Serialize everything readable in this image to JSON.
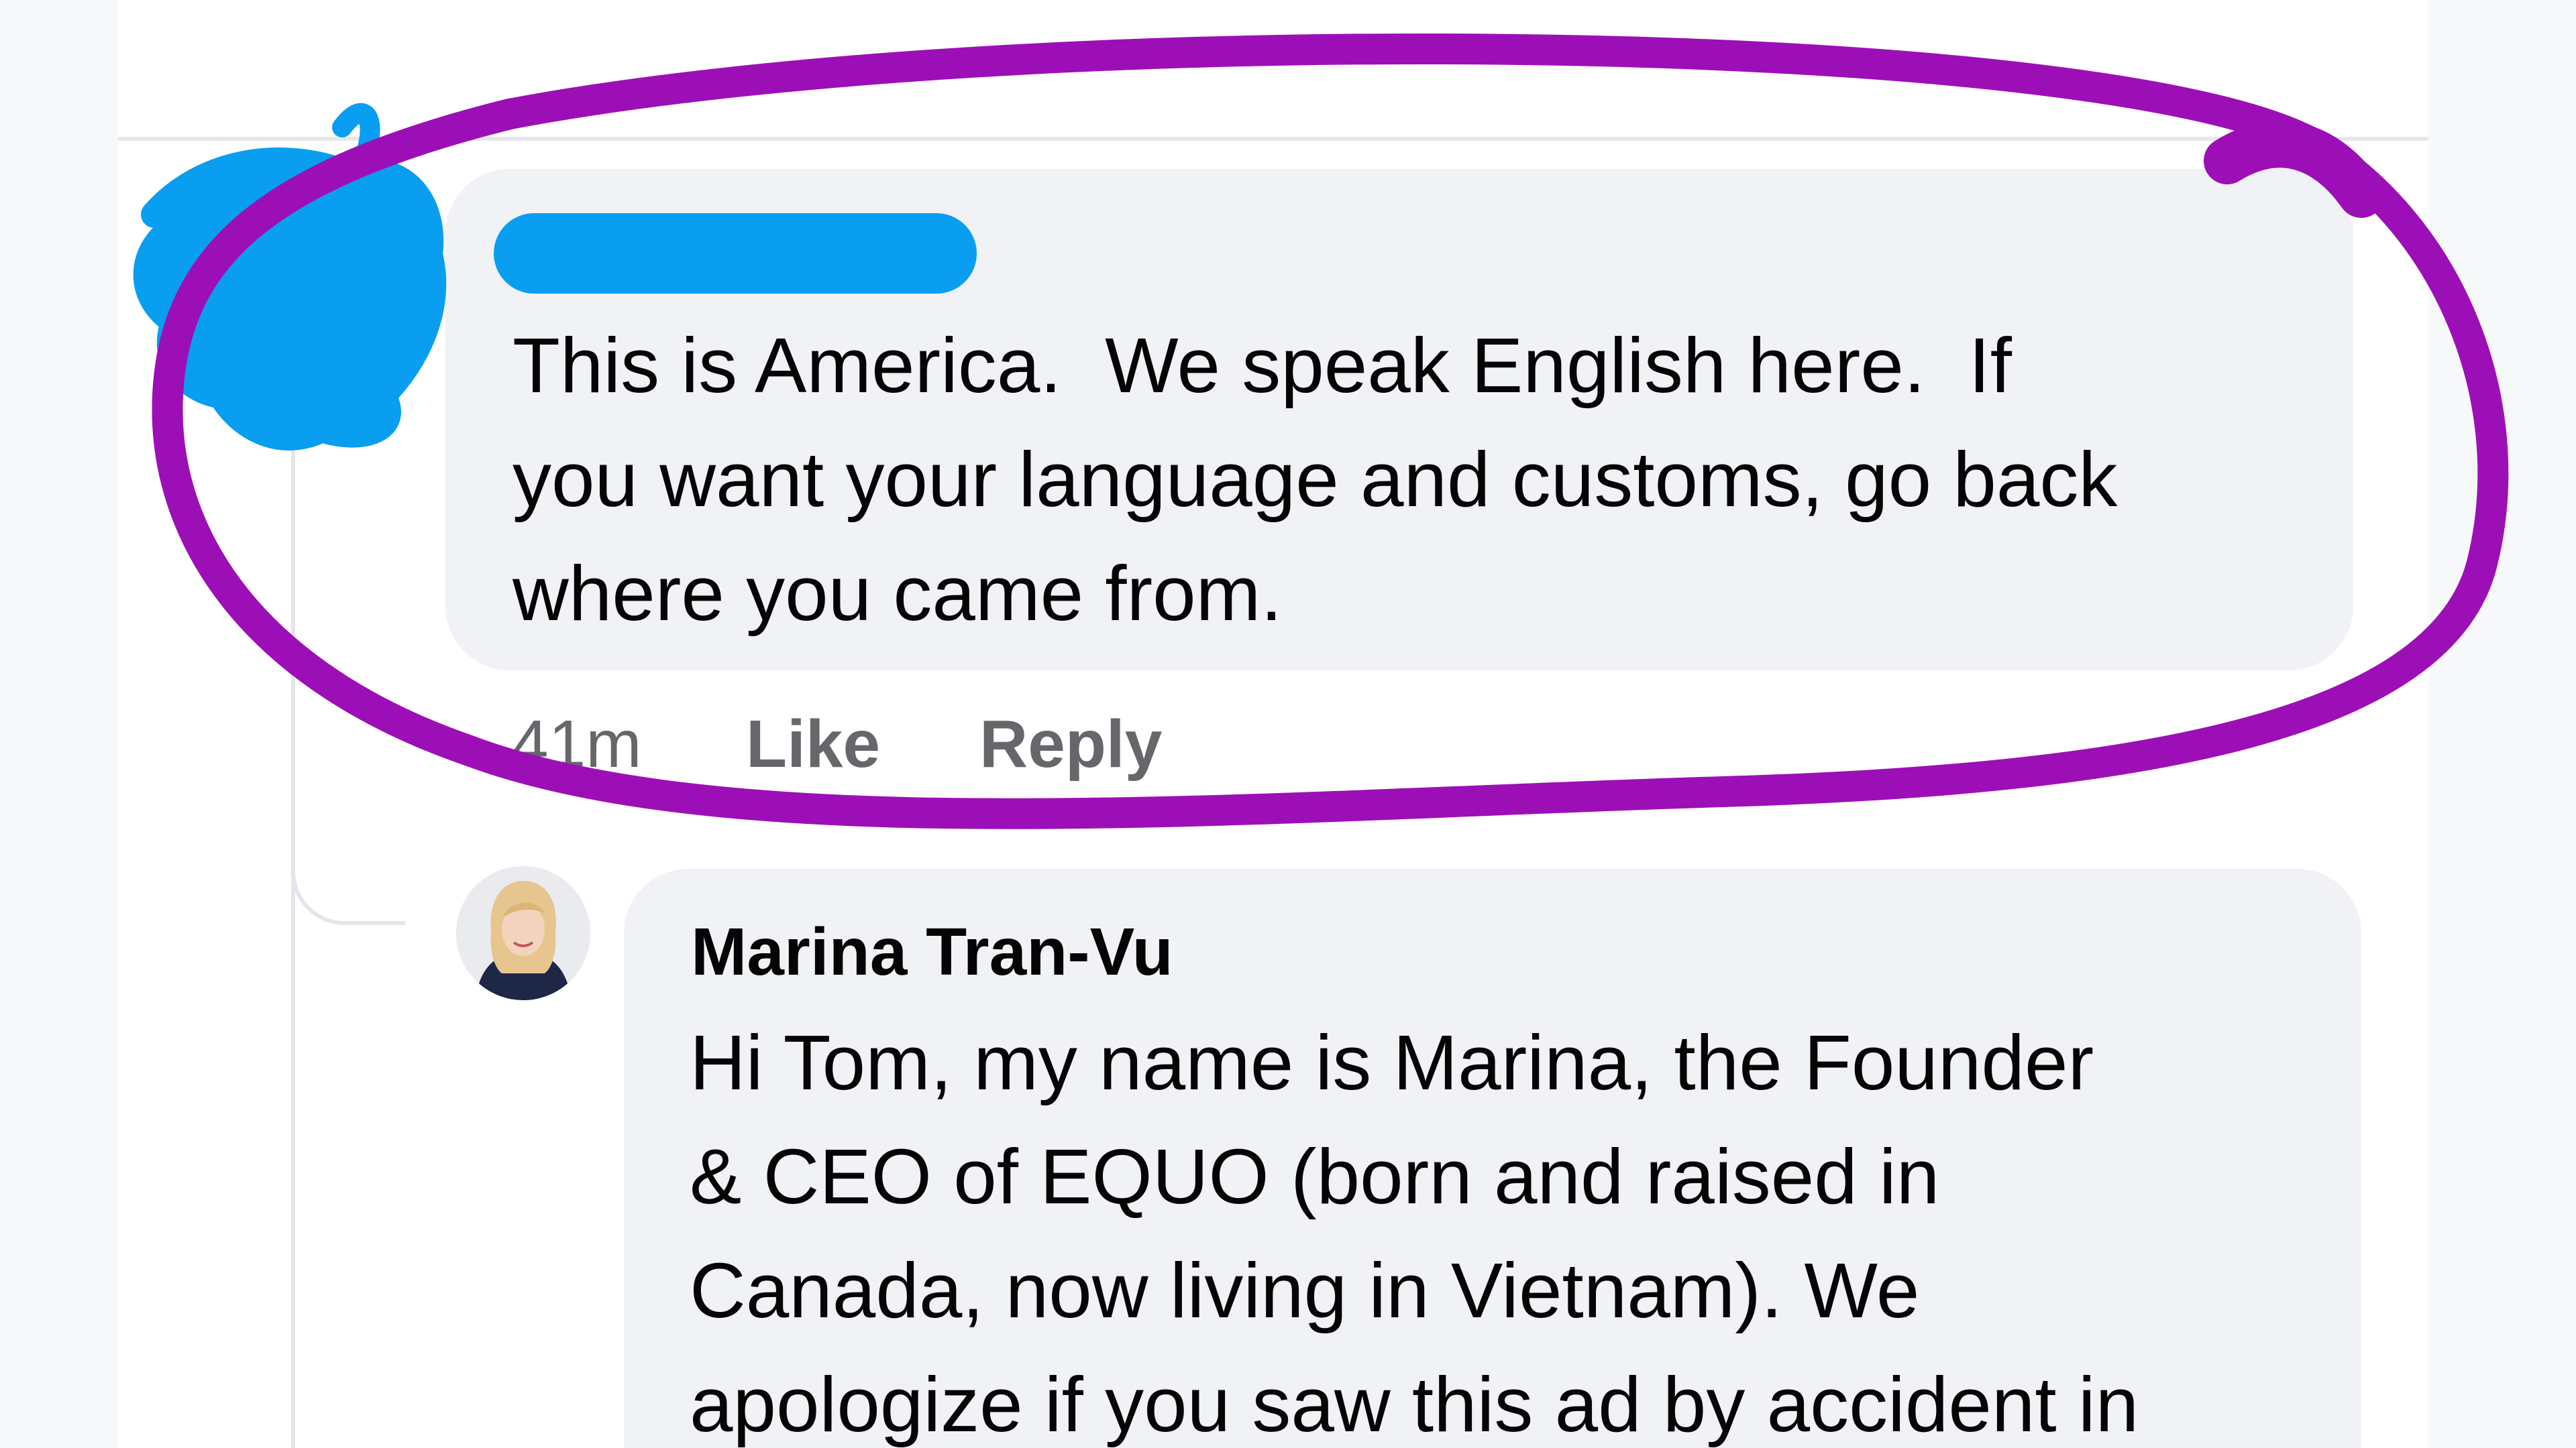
{
  "comment_1": {
    "text": "This is America.  We speak English here.  If\nyou want your language and customs, go back\nwhere you came from.",
    "time": "41m",
    "like_label": "Like",
    "reply_label": "Reply"
  },
  "comment_2": {
    "author": "Marina Tran-Vu",
    "text": "Hi Tom, my name is Marina, the Founder\n& CEO of EQUO (born and raised in\nCanada, now living in Vietnam). We\napologize if you saw this ad by accident in"
  },
  "colors": {
    "highlight_circle": "#9d0fb6",
    "redaction": "#0a9ef0",
    "bubble": "#f0f2f5",
    "meta_text": "#65676b"
  }
}
